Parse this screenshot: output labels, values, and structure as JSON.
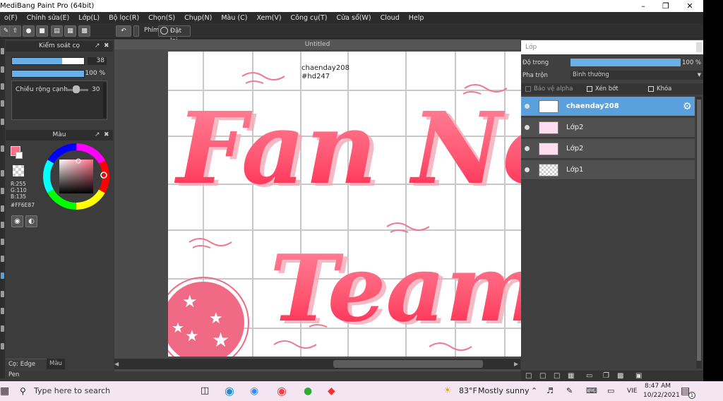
{
  "app": {
    "title": "MediBang Paint Pro (64bit)"
  },
  "menu": {
    "items": [
      "o(F)",
      "Chỉnh sửa(E)",
      "Lớp(L)",
      "Bộ lọc(R)",
      "Chọn(S)",
      "Chụp(N)",
      "Màu (C)",
      "Xem(V)",
      "Công cụ(T)",
      "Cửa sổ(W)",
      "Cloud",
      "Help"
    ]
  },
  "toolbar": {
    "phim_label": "Phím",
    "reset_label": "Đặt lại"
  },
  "brush_panel": {
    "title": "Kiểm soát cọ",
    "size_value": "38",
    "size_fill": 0.7,
    "opacity_value": "100 %",
    "opacity_fill": 1.0,
    "edge_label": "Chiều rộng cạnh",
    "edge_value": "30"
  },
  "color_panel": {
    "title": "Màu",
    "r": "R:255",
    "g": "G:110",
    "b": "B:135",
    "hex": "#FF6E87",
    "current_color": "#FF6E87"
  },
  "bottom_tabs": {
    "brush_tab": "Cọ: Edge Pen",
    "color_tab": "Màu"
  },
  "document": {
    "tab_title": "Untitled",
    "watermark_line1": "chaenday208",
    "watermark_line2": "#hd247"
  },
  "layer_panel": {
    "title": "Lớp",
    "opacity_label": "Độ trong",
    "opacity_value": "100 %",
    "opacity_fill": 1.0,
    "blend_label": "Pha trộn",
    "blend_value": "Bình thường",
    "protect_alpha": "Bảo vệ alpha",
    "clipping": "Xén bớt",
    "lock": "Khóa",
    "layers": [
      {
        "name": "chaenday208",
        "selected": true
      },
      {
        "name": "Lớp2",
        "selected": false
      },
      {
        "name": "Lớp2",
        "selected": false
      },
      {
        "name": "Lớp1",
        "selected": false
      }
    ]
  },
  "taskbar": {
    "search_placeholder": "Type here to search",
    "weather_temp": "83°F",
    "weather_text": "Mostly sunny",
    "lang": "VIE",
    "time": "8:47 AM",
    "date": "10/22/2021",
    "notif_count": "1"
  }
}
